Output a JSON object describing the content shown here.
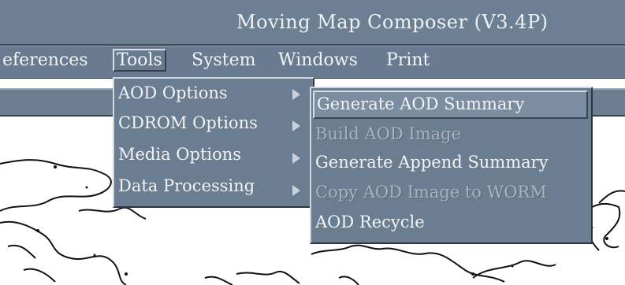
{
  "app": {
    "title": "Moving Map Composer  (V3.4P)"
  },
  "menubar": {
    "items": [
      {
        "label": "eferences"
      },
      {
        "label": "Tools"
      },
      {
        "label": "System"
      },
      {
        "label": "Windows"
      },
      {
        "label": "Print"
      }
    ]
  },
  "tools_menu": {
    "items": [
      {
        "label": "AOD Options"
      },
      {
        "label": "CDROM  Options"
      },
      {
        "label": "Media Options"
      },
      {
        "label": "Data Processing"
      }
    ]
  },
  "aod_submenu": {
    "items": [
      {
        "label": "Generate AOD Summary",
        "enabled": true
      },
      {
        "label": "Build AOD Image",
        "enabled": false
      },
      {
        "label": "Generate Append Summary",
        "enabled": true
      },
      {
        "label": "Copy AOD Image to WORM",
        "enabled": false
      },
      {
        "label": "AOD Recycle",
        "enabled": true
      }
    ]
  },
  "colors": {
    "chrome": "#6d7f93",
    "menu": "#6b7d91",
    "text": "#f1f3f6",
    "disabled_text": "#a9b4c0"
  }
}
